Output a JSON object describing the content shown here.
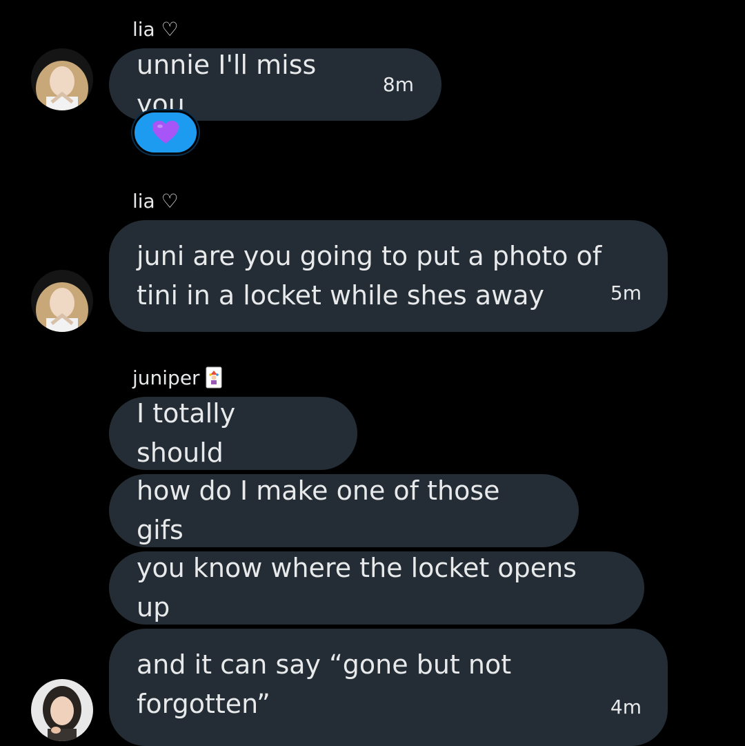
{
  "messages": [
    {
      "sender": "lia ♡",
      "text": "unnie I'll miss you",
      "time": "8m",
      "reaction": "purple-heart"
    },
    {
      "sender": "lia ♡",
      "text_lines": [
        "juni are you going to put a photo of",
        "tini in a locket while shes away"
      ],
      "time": "5m"
    },
    {
      "sender": "juniper",
      "sender_icon": "joker-card-icon",
      "group": [
        {
          "text": "I totally should"
        },
        {
          "text": "how do I make one of those gifs"
        },
        {
          "text": "you know where the locket opens up"
        },
        {
          "text_lines": [
            "and it can say “gone but not",
            "forgotten”"
          ],
          "time": "4m"
        }
      ]
    }
  ],
  "colors": {
    "background": "#000000",
    "bubble": "#242d35",
    "text": "#e7e9ea",
    "reaction_bg": "#1d9bf0",
    "heart": "#a855f7"
  }
}
